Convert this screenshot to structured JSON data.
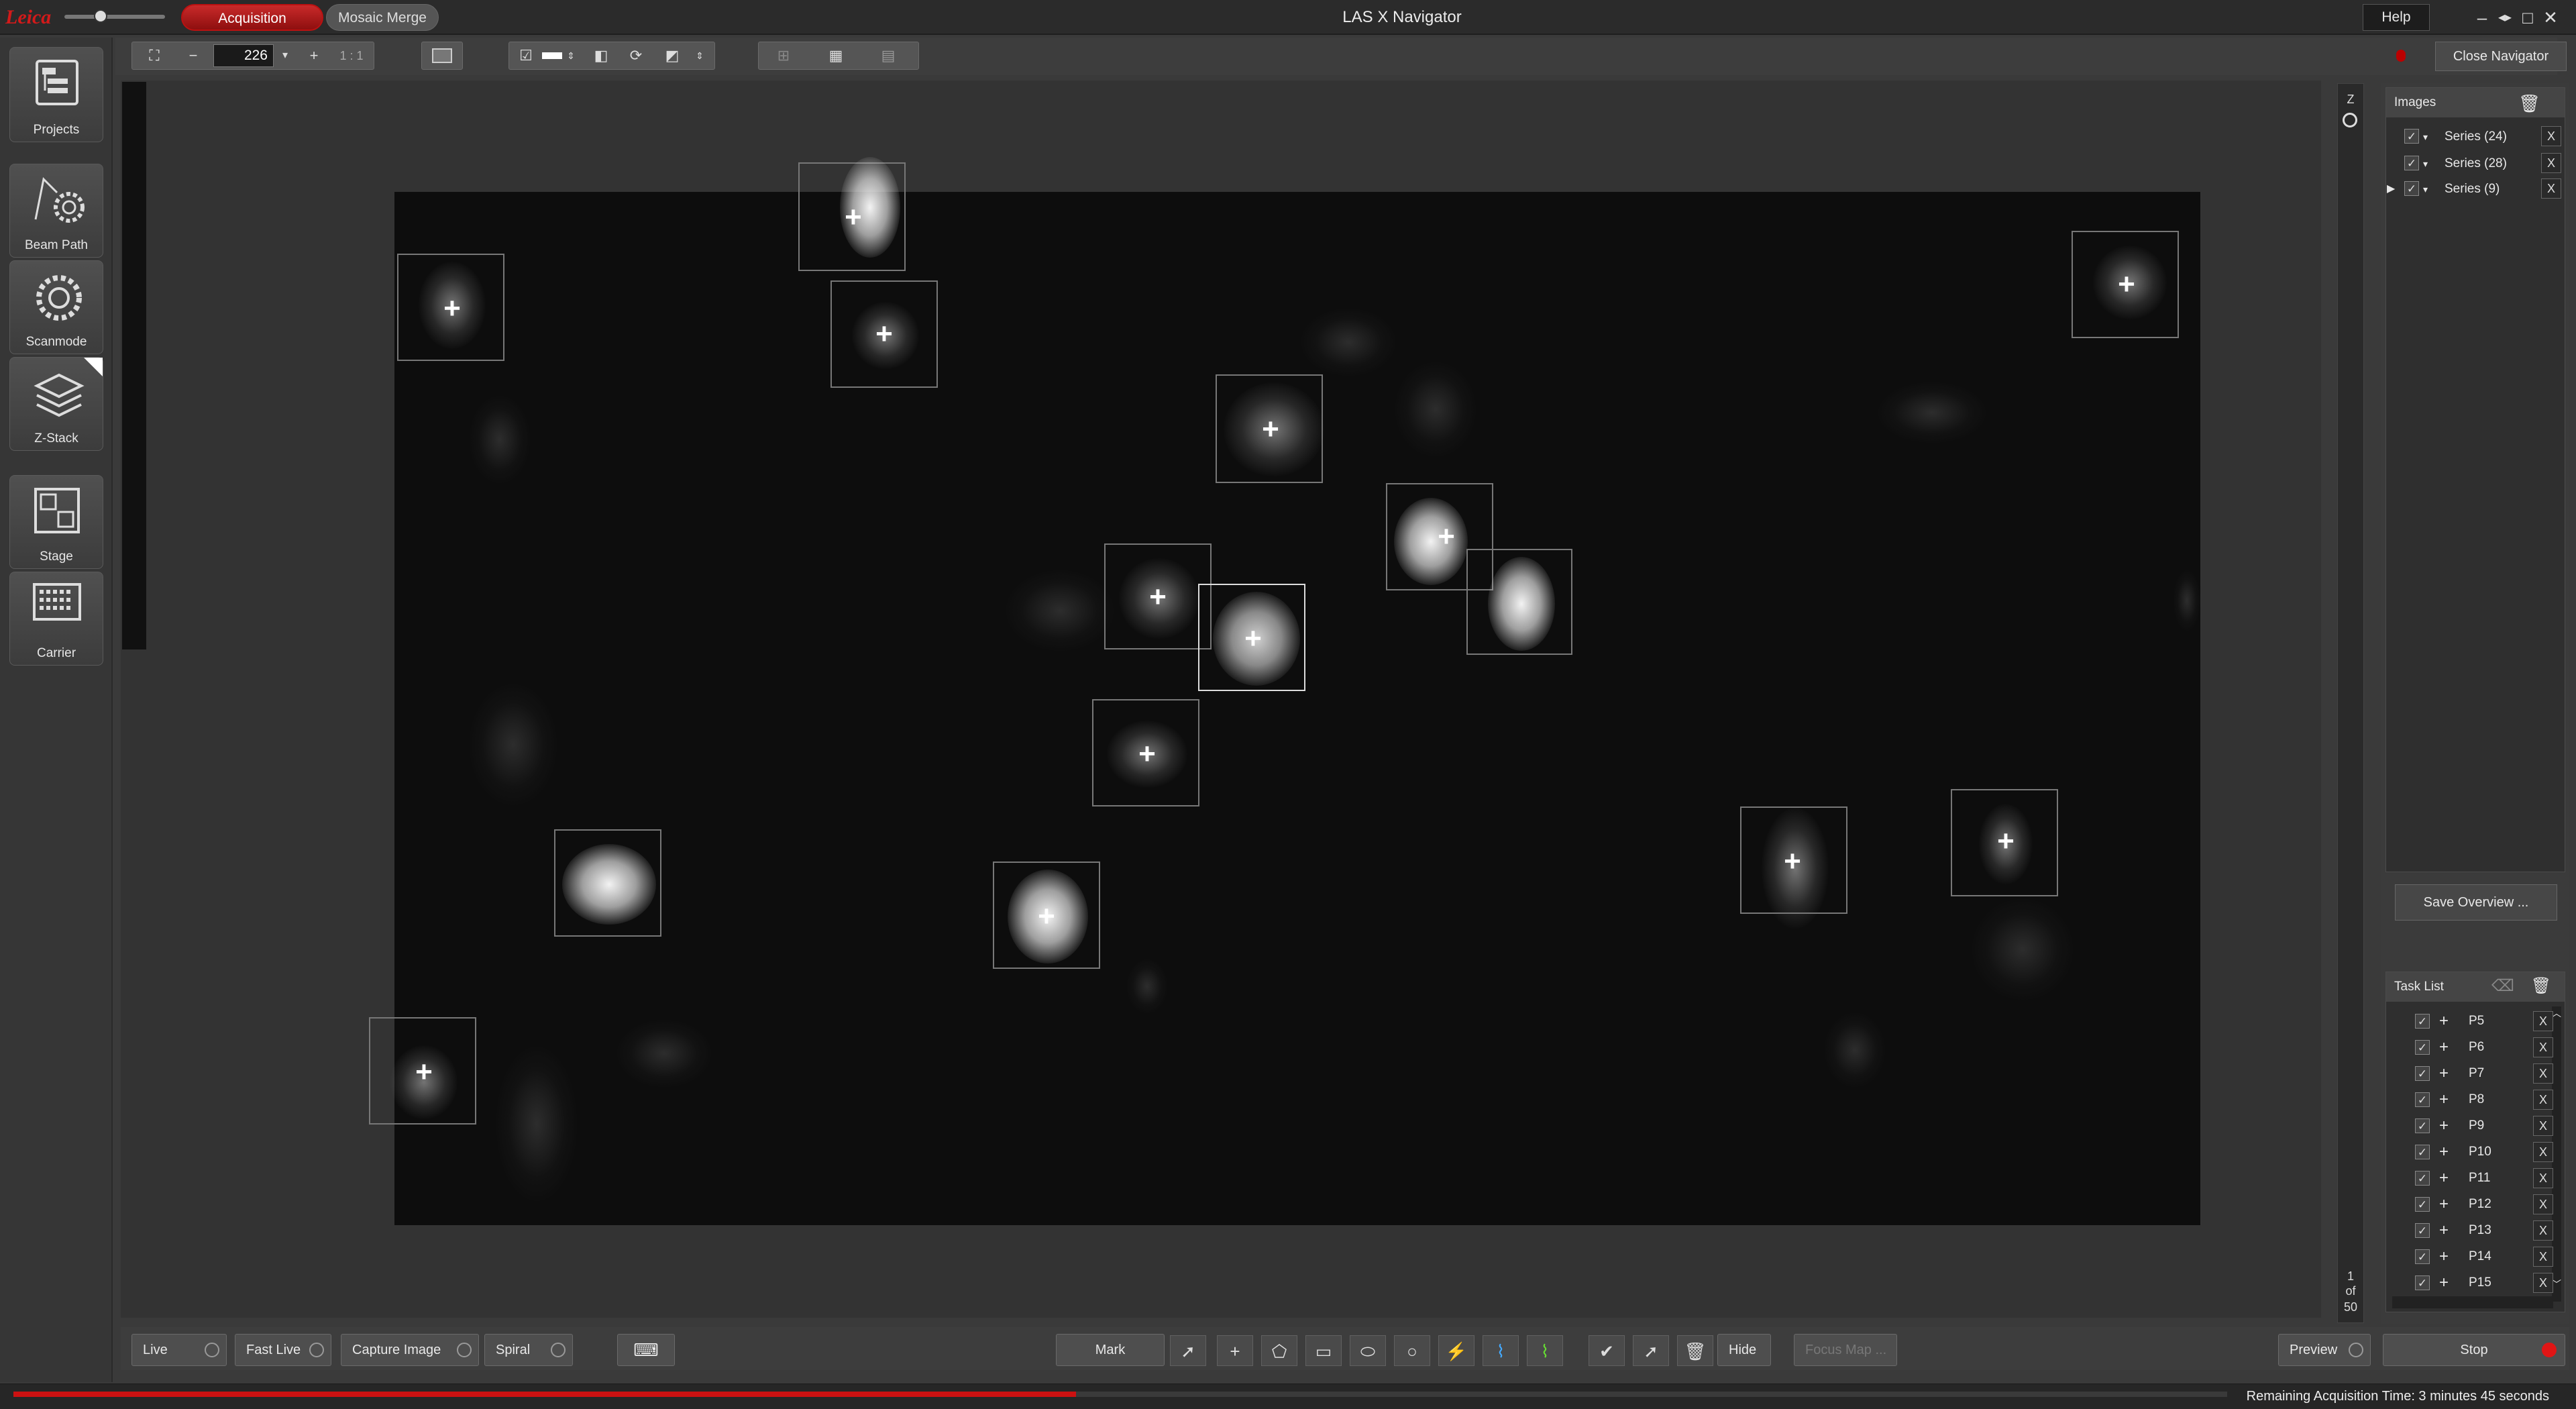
{
  "window": {
    "title": "LAS X Navigator",
    "help_label": "Help",
    "close_navigator_label": "Close Navigator"
  },
  "tabs": [
    {
      "label": "Acquisition",
      "active": true
    },
    {
      "label": "Mosaic Merge",
      "active": false
    }
  ],
  "toolbar": {
    "zoom_value": "226",
    "one_to_one_label": "1 : 1"
  },
  "sidebar": {
    "items": [
      {
        "label": "Projects",
        "icon": "projects-icon"
      },
      {
        "label": "Beam Path",
        "icon": "beam-path-icon"
      },
      {
        "label": "Scanmode",
        "icon": "scanmode-icon"
      },
      {
        "label": "Z-Stack",
        "icon": "z-stack-icon"
      },
      {
        "label": "Stage",
        "icon": "stage-icon"
      },
      {
        "label": "Carrier",
        "icon": "carrier-icon"
      }
    ]
  },
  "zslider": {
    "label": "Z",
    "position_line1": "1",
    "position_line2": "of",
    "position_line3": "50"
  },
  "images_panel": {
    "title": "Images",
    "series": [
      {
        "label": "Series (24)"
      },
      {
        "label": "Series (28)"
      },
      {
        "label": "Series (9)"
      }
    ],
    "save_overview_label": "Save Overview ..."
  },
  "task_list": {
    "title": "Task List",
    "items": [
      {
        "label": "P5"
      },
      {
        "label": "P6"
      },
      {
        "label": "P7"
      },
      {
        "label": "P8"
      },
      {
        "label": "P9"
      },
      {
        "label": "P10"
      },
      {
        "label": "P11"
      },
      {
        "label": "P12"
      },
      {
        "label": "P13"
      },
      {
        "label": "P14"
      },
      {
        "label": "P15"
      }
    ]
  },
  "bottom": {
    "live_label": "Live",
    "fast_live_label": "Fast Live",
    "capture_label": "Capture Image",
    "spiral_label": "Spiral",
    "mark_label": "Mark",
    "hide_label": "Hide",
    "focus_map_label": "Focus Map ...",
    "preview_label": "Preview",
    "stop_label": "Stop"
  },
  "status": {
    "remaining_text": "Remaining Acquisition Time: 3 minutes 45 seconds",
    "progress_percent": 48
  },
  "colors": {
    "accent": "#c92a2a",
    "stop_indicator": "#e01515"
  }
}
